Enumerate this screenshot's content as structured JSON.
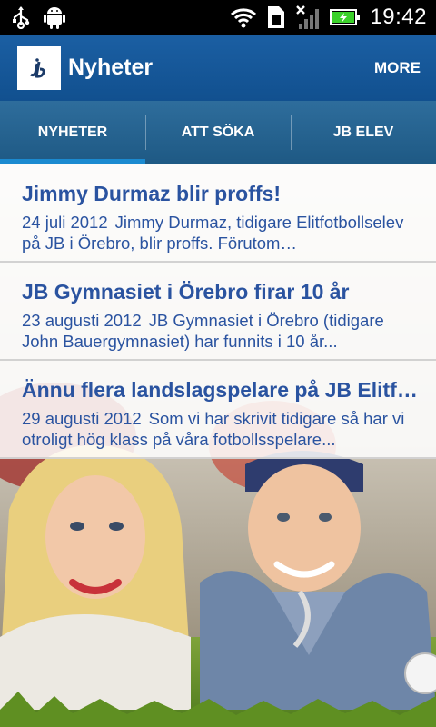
{
  "status_bar": {
    "time": "19:42",
    "icons": [
      "usb-icon",
      "android-debug-icon",
      "wifi-icon",
      "sim-card-icon",
      "no-signal-icon",
      "battery-charging-icon"
    ]
  },
  "action_bar": {
    "title": "Nyheter",
    "more_label": "MORE",
    "logo_icon": "jb-logo-icon"
  },
  "tabs": [
    {
      "label": "NYHETER",
      "active": true
    },
    {
      "label": "ATT SÖKA",
      "active": false
    },
    {
      "label": "JB ELEV",
      "active": false
    }
  ],
  "news": [
    {
      "title": "Jimmy Durmaz blir proffs!",
      "date": "24 juli 2012",
      "summary": "Jimmy Durmaz, tidigare Elitfotbollselev på JB i Örebro, blir proffs. Förutom Elitfotbollsgymnasiet..."
    },
    {
      "title": "JB Gymnasiet i Örebro firar 10 år",
      "date": "23 augusti 2012",
      "summary": "JB Gymnasiet i Örebro (tidigare John Bauergymnasiet) har funnits i 10 år..."
    },
    {
      "title": "Ännu flera landslagspelare på JB Elitfotbollsgymnasiet",
      "date": "29 augusti 2012",
      "summary": "Som vi har skrivit tidigare så har vi otroligt hög klass på våra fotbollsspelare..."
    }
  ],
  "colors": {
    "action_bar": "#1b5fa3",
    "tab_bar": "#2e6d9c",
    "tab_indicator": "#1b8ad0",
    "news_text": "#2a53a0"
  }
}
